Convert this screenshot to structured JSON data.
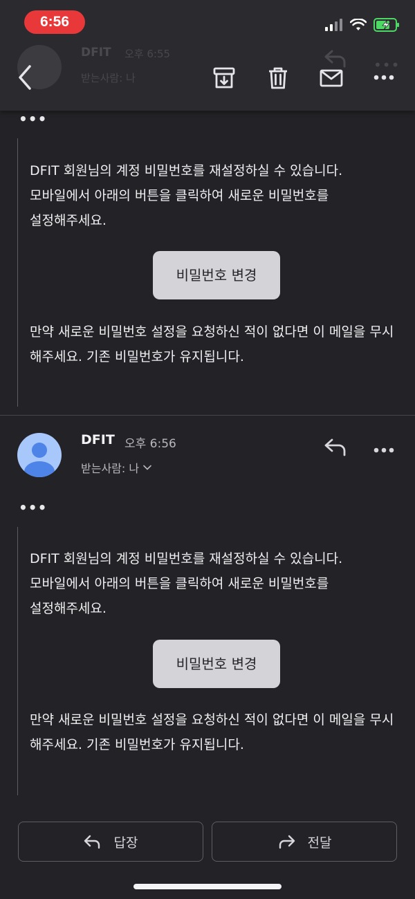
{
  "status_bar": {
    "time": "6:56",
    "icons": [
      "signal-icon",
      "wifi-icon",
      "battery-charging-icon"
    ],
    "time_pill_color": "#e8383a",
    "battery_color": "#4cd964"
  },
  "toolbar": {
    "icons": [
      "back-icon",
      "archive-icon",
      "trash-icon",
      "mail-icon",
      "more-icon"
    ],
    "ghost_sender": "DFIT",
    "ghost_time": "오후 6:55",
    "ghost_recipient": "받는사람: 나"
  },
  "message1": {
    "ellipsis": "•••",
    "body_line1": "DFIT 회원님의 계정 비밀번호를 재설정하실 수 있습니다.",
    "body_line2": "모바일에서 아래의 버튼을 클릭하여 새로운 비밀번호를 설정해주세요.",
    "button_label": "비밀번호 변경",
    "notice": "  만약 새로운 비밀번호 설정을 요청하신 적이 없다면  이 메일을 무시해주세요.  기존 비밀번호가 유지됩니다."
  },
  "message2": {
    "sender": "DFIT",
    "time": "오후 6:56",
    "recipient": "받는사람: 나",
    "ellipsis": "•••",
    "body_line1": "DFIT 회원님의 계정 비밀번호를 재설정하실 수 있습니다.",
    "body_line2": "모바일에서 아래의 버튼을 클릭하여 새로운 비밀번호를 설정해주세요.",
    "button_label": "비밀번호 변경",
    "notice": "  만약 새로운 비밀번호 설정을 요청하신 적이 없다면  이 메일을 무시해주세요.  기존 비밀번호가 유지됩니다.",
    "avatar_color": "#a8c7fa",
    "avatar_figure_color": "#4e83e8"
  },
  "bottom_bar": {
    "reply_label": "답장",
    "forward_label": "전달"
  }
}
